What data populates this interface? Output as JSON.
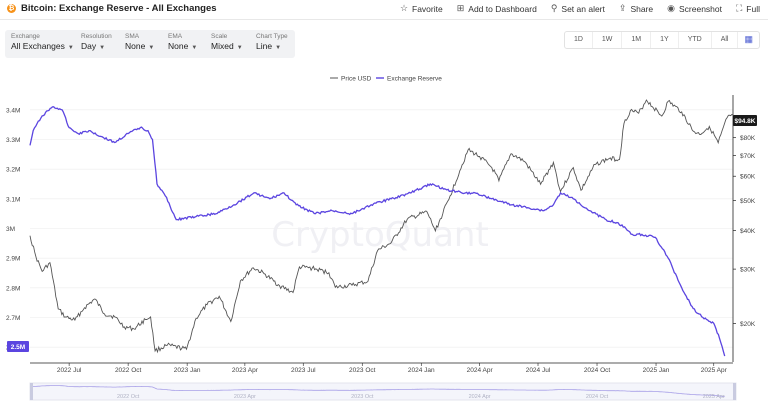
{
  "header": {
    "logo_glyph": "₿",
    "title": "Bitcoin: Exchange Reserve - All Exchanges",
    "actions": [
      {
        "icon": "star-icon",
        "glyph": "☆",
        "label": "Favorite"
      },
      {
        "icon": "add-dashboard-icon",
        "glyph": "⊞",
        "label": "Add to Dashboard"
      },
      {
        "icon": "alert-icon",
        "glyph": "⚲",
        "label": "Set an alert"
      },
      {
        "icon": "share-icon",
        "glyph": "⇪",
        "label": "Share"
      },
      {
        "icon": "camera-icon",
        "glyph": "◉",
        "label": "Screenshot"
      },
      {
        "icon": "fullscreen-icon",
        "glyph": "⛶",
        "label": "Full"
      }
    ]
  },
  "controls": [
    {
      "label": "Exchange",
      "value": "All Exchanges"
    },
    {
      "label": "Resolution",
      "value": "Day"
    },
    {
      "label": "SMA",
      "value": "None"
    },
    {
      "label": "EMA",
      "value": "None"
    },
    {
      "label": "Scale",
      "value": "Mixed"
    },
    {
      "label": "Chart Type",
      "value": "Line"
    }
  ],
  "ranges": [
    "1D",
    "1W",
    "1M",
    "1Y",
    "YTD",
    "All"
  ],
  "watermark": "CryptoQuant",
  "chart_data": {
    "type": "line",
    "legend_position": "top-center",
    "colors": {
      "price": "#555555",
      "reserve": "#5b45e0",
      "grid": "#ececec"
    },
    "x_ticks": [
      "2022 Jul",
      "2022 Oct",
      "2023 Jan",
      "2023 Apr",
      "2023 Jul",
      "2023 Oct",
      "2024 Jan",
      "2024 Apr",
      "2024 Jul",
      "2024 Oct",
      "2025 Jan",
      "2025 Apr"
    ],
    "x_tick_dates": [
      "2022-07-01",
      "2022-10-01",
      "2023-01-01",
      "2023-04-01",
      "2023-07-01",
      "2023-10-01",
      "2024-01-01",
      "2024-04-01",
      "2024-07-01",
      "2024-10-01",
      "2025-01-01",
      "2025-04-01"
    ],
    "x_range": [
      "2022-05-01",
      "2025-05-01"
    ],
    "left_axis": {
      "ylim": [
        2.55,
        3.45
      ],
      "ticks": [
        2.6,
        2.7,
        2.8,
        2.9,
        3.0,
        3.1,
        3.2,
        3.3,
        3.4
      ],
      "tick_labels": [
        "2.6M",
        "2.7M",
        "2.8M",
        "2.9M",
        "3M",
        "3.1M",
        "3.2M",
        "3.3M",
        "3.4M"
      ],
      "unit": "M BTC"
    },
    "right_axis": {
      "scale": "log",
      "ylim": [
        15000,
        110000
      ],
      "ticks": [
        20000,
        30000,
        40000,
        50000,
        60000,
        70000,
        80000,
        90000
      ],
      "tick_labels": [
        "$20K",
        "$30K",
        "$40K",
        "$50K",
        "$60K",
        "$70K",
        "$80K",
        "$90K"
      ]
    },
    "series": [
      {
        "name": "Price USD",
        "axis": "right",
        "x": [
          "2022-05-01",
          "2022-05-10",
          "2022-05-20",
          "2022-06-01",
          "2022-06-14",
          "2022-06-25",
          "2022-07-10",
          "2022-07-25",
          "2022-08-10",
          "2022-08-25",
          "2022-09-10",
          "2022-09-25",
          "2022-10-10",
          "2022-10-28",
          "2022-11-05",
          "2022-11-12",
          "2022-12-01",
          "2022-12-31",
          "2023-01-15",
          "2023-02-01",
          "2023-02-20",
          "2023-03-10",
          "2023-03-25",
          "2023-04-14",
          "2023-05-01",
          "2023-05-25",
          "2023-06-15",
          "2023-06-25",
          "2023-07-15",
          "2023-08-10",
          "2023-08-20",
          "2023-09-15",
          "2023-10-10",
          "2023-10-25",
          "2023-11-15",
          "2023-12-10",
          "2024-01-10",
          "2024-01-23",
          "2024-02-15",
          "2024-03-01",
          "2024-03-14",
          "2024-04-01",
          "2024-04-20",
          "2024-05-01",
          "2024-05-20",
          "2024-06-10",
          "2024-07-05",
          "2024-07-25",
          "2024-08-05",
          "2024-08-25",
          "2024-09-06",
          "2024-09-28",
          "2024-10-20",
          "2024-11-05",
          "2024-11-12",
          "2024-11-22",
          "2024-12-05",
          "2024-12-17",
          "2025-01-10",
          "2025-01-20",
          "2025-02-10",
          "2025-02-28",
          "2025-03-10",
          "2025-03-25",
          "2025-04-08",
          "2025-04-22",
          "2025-05-01"
        ],
        "y": [
          38500,
          33000,
          29500,
          31500,
          22300,
          21000,
          20500,
          22500,
          24000,
          21500,
          21000,
          19500,
          19200,
          20600,
          21000,
          16300,
          17000,
          16500,
          20800,
          23000,
          24500,
          20300,
          27500,
          30300,
          29000,
          26500,
          25200,
          30500,
          30200,
          29200,
          26200,
          26600,
          27400,
          34500,
          36500,
          43500,
          46000,
          39900,
          51800,
          62500,
          73000,
          69500,
          64000,
          58000,
          71000,
          67000,
          56500,
          66500,
          53500,
          64000,
          54000,
          65500,
          68500,
          68000,
          89000,
          98000,
          96000,
          106000,
          94000,
          105000,
          97000,
          84000,
          82000,
          87000,
          77000,
          93000,
          94800
        ]
      },
      {
        "name": "Exchange Reserve",
        "axis": "left",
        "x": [
          "2022-05-01",
          "2022-05-06",
          "2022-05-20",
          "2022-06-05",
          "2022-06-20",
          "2022-07-01",
          "2022-07-15",
          "2022-08-01",
          "2022-08-20",
          "2022-09-10",
          "2022-10-01",
          "2022-10-20",
          "2022-11-01",
          "2022-11-08",
          "2022-11-15",
          "2022-11-28",
          "2022-12-15",
          "2023-01-15",
          "2023-02-15",
          "2023-03-15",
          "2023-04-15",
          "2023-05-10",
          "2023-06-01",
          "2023-06-20",
          "2023-07-20",
          "2023-08-15",
          "2023-09-15",
          "2023-10-15",
          "2023-11-15",
          "2023-12-15",
          "2024-01-15",
          "2024-02-10",
          "2024-03-10",
          "2024-03-25",
          "2024-04-20",
          "2024-05-20",
          "2024-06-15",
          "2024-07-10",
          "2024-07-25",
          "2024-08-05",
          "2024-08-25",
          "2024-09-20",
          "2024-10-15",
          "2024-11-01",
          "2024-11-15",
          "2024-11-25",
          "2024-12-10",
          "2024-12-31",
          "2025-01-20",
          "2025-02-10",
          "2025-02-28",
          "2025-03-15",
          "2025-04-01",
          "2025-04-10",
          "2025-04-18"
        ],
        "y": [
          3.28,
          3.33,
          3.38,
          3.41,
          3.4,
          3.34,
          3.32,
          3.33,
          3.31,
          3.29,
          3.32,
          3.34,
          3.33,
          3.3,
          3.15,
          3.11,
          3.03,
          3.04,
          3.05,
          3.08,
          3.12,
          3.1,
          3.12,
          3.08,
          3.05,
          3.06,
          3.05,
          3.08,
          3.1,
          3.12,
          3.15,
          3.13,
          3.12,
          3.12,
          3.1,
          3.08,
          3.07,
          3.06,
          3.08,
          3.12,
          3.1,
          3.06,
          3.03,
          3.02,
          3.0,
          2.98,
          2.98,
          2.97,
          2.9,
          2.8,
          2.73,
          2.7,
          2.68,
          2.63,
          2.57
        ]
      }
    ],
    "price_label": "$94.8K",
    "reserve_label": "2.5M"
  }
}
